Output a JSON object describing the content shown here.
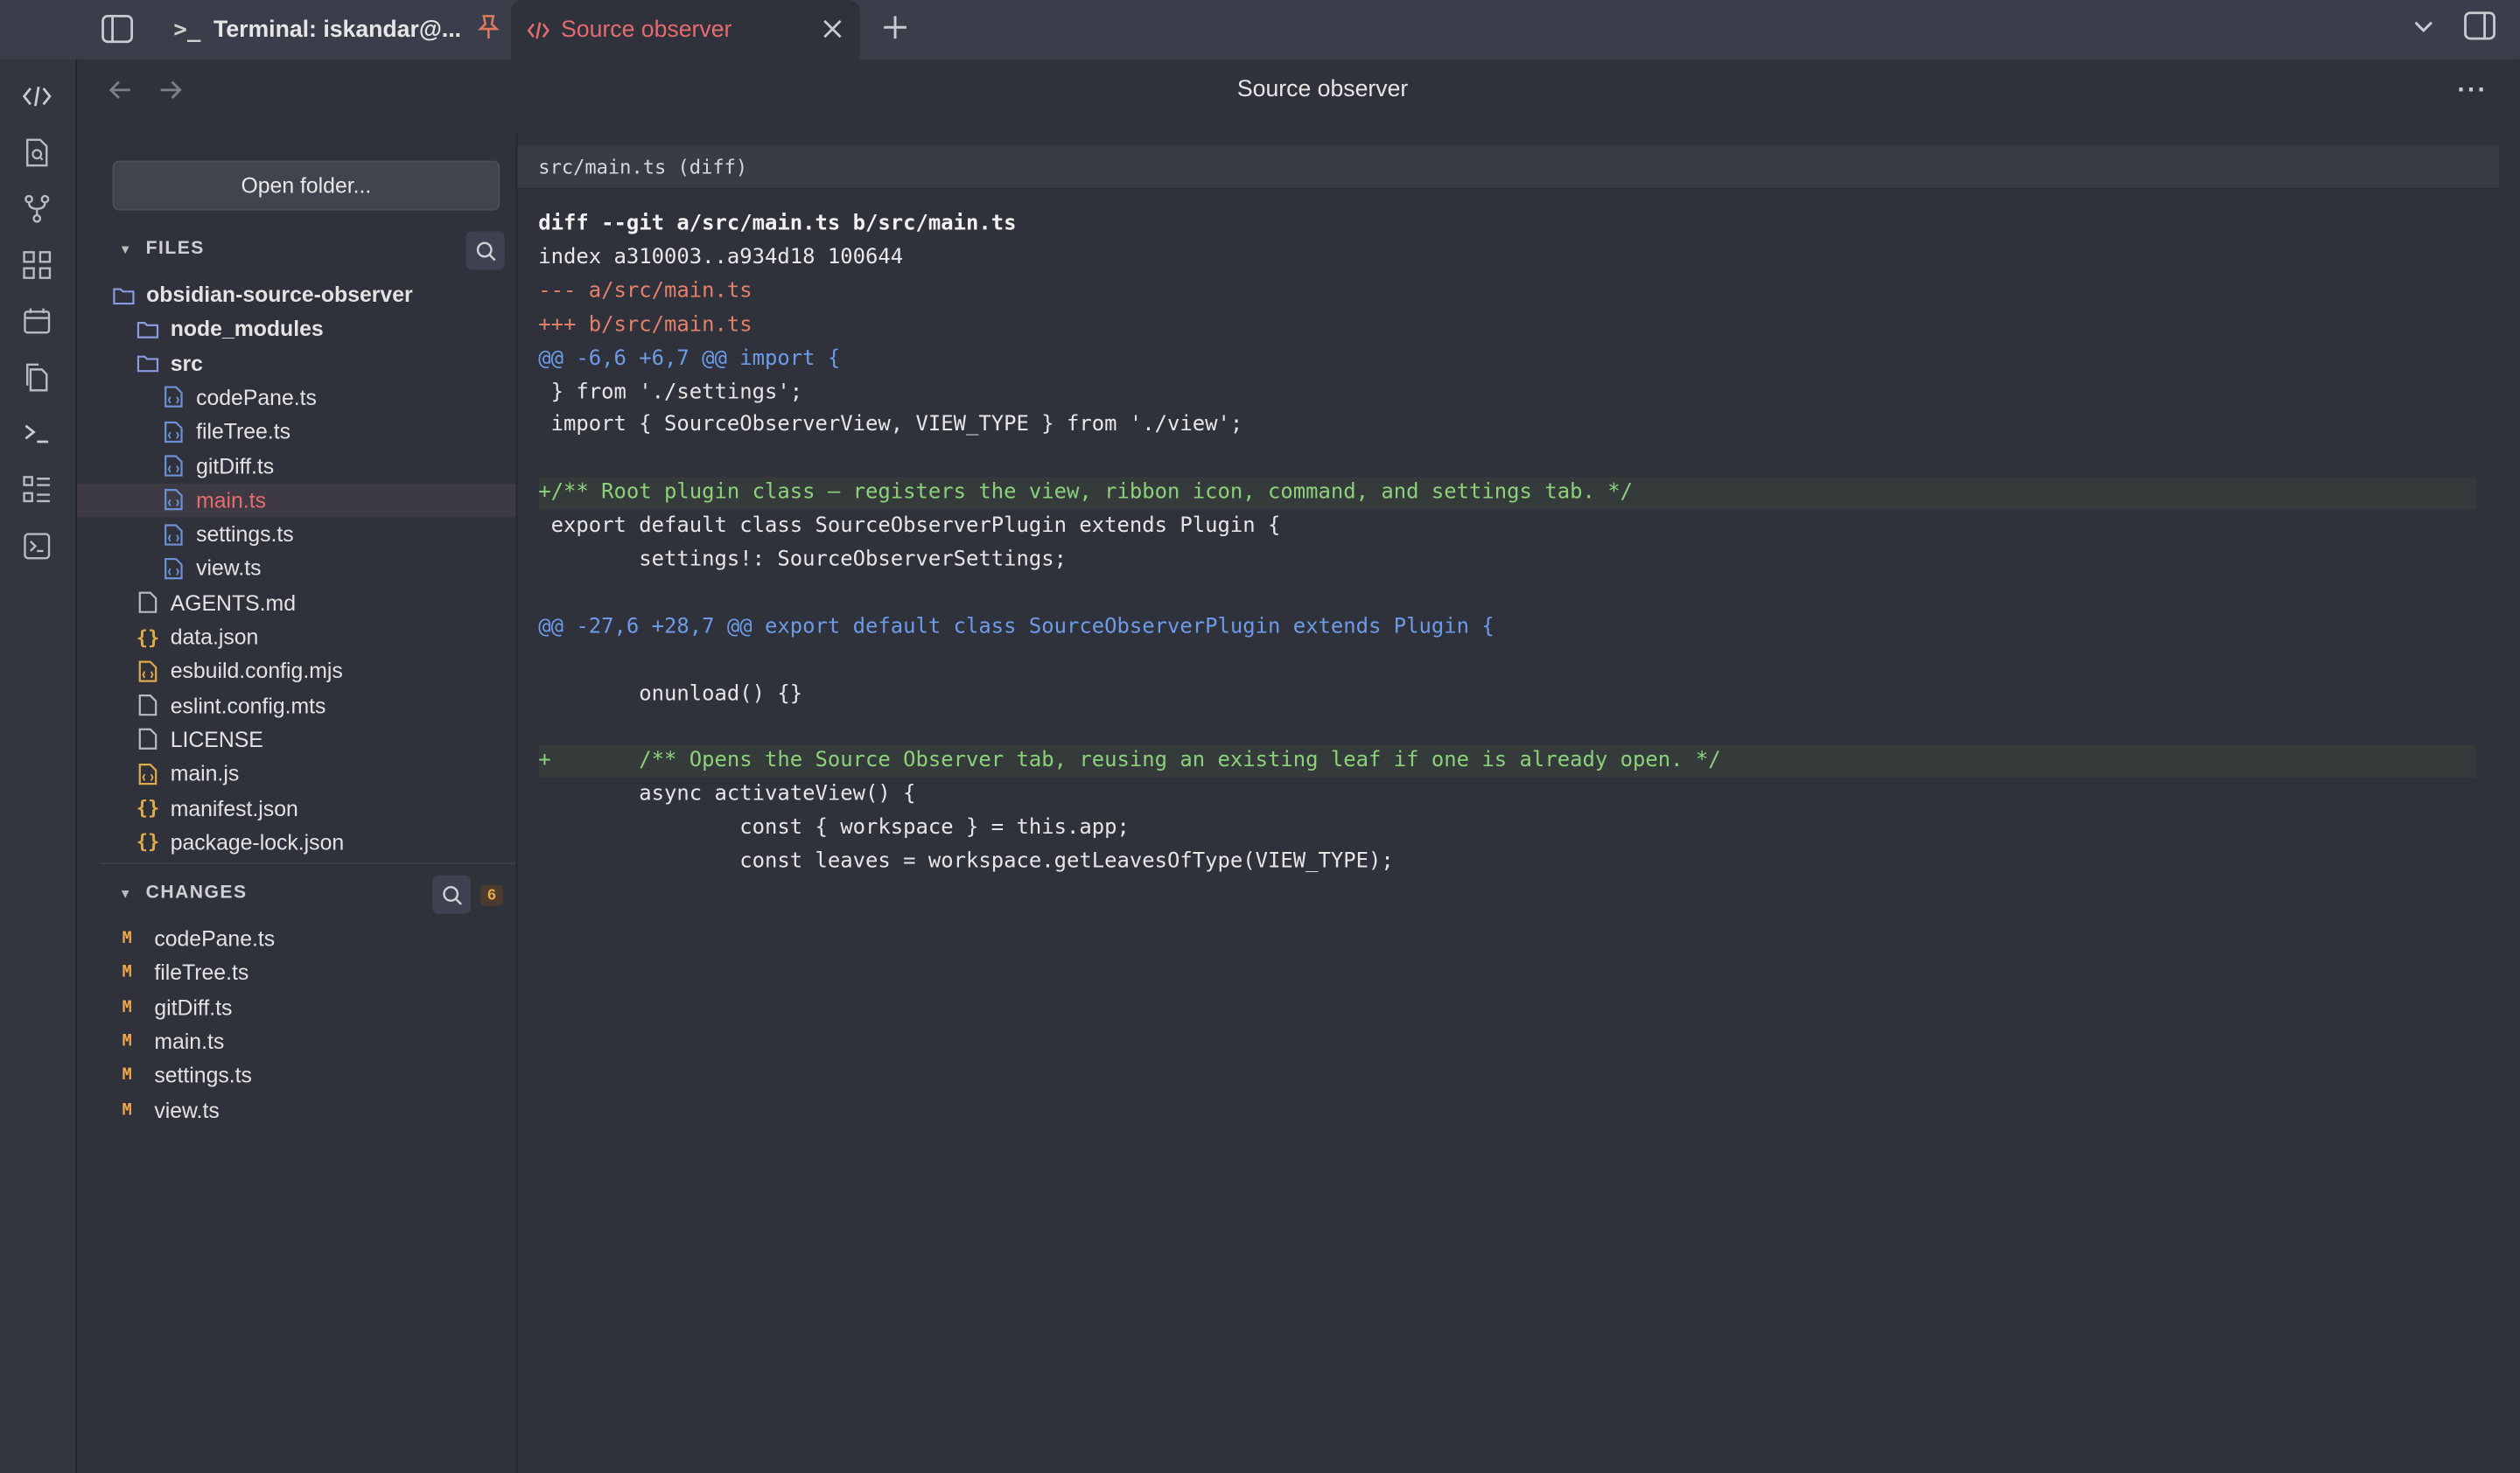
{
  "tabs": [
    {
      "label": "Terminal: iskandar@...",
      "icon": "terminal-icon",
      "pinned": true
    },
    {
      "label": "Source observer",
      "icon": "code-icon",
      "active": true
    }
  ],
  "header": {
    "title": "Source observer"
  },
  "sidebar": {
    "open_folder_label": "Open folder...",
    "files_heading": "FILES",
    "tree": [
      {
        "label": "obsidian-source-observer",
        "type": "folder",
        "depth": 0
      },
      {
        "label": "node_modules",
        "type": "folder",
        "depth": 1
      },
      {
        "label": "src",
        "type": "folder",
        "depth": 1
      },
      {
        "label": "codePane.ts",
        "type": "ts",
        "depth": 2
      },
      {
        "label": "fileTree.ts",
        "type": "ts",
        "depth": 2
      },
      {
        "label": "gitDiff.ts",
        "type": "ts",
        "depth": 2
      },
      {
        "label": "main.ts",
        "type": "ts",
        "depth": 2,
        "selected": true
      },
      {
        "label": "settings.ts",
        "type": "ts",
        "depth": 2
      },
      {
        "label": "view.ts",
        "type": "ts",
        "depth": 2
      },
      {
        "label": "AGENTS.md",
        "type": "doc",
        "depth": 1
      },
      {
        "label": "data.json",
        "type": "json",
        "depth": 1
      },
      {
        "label": "esbuild.config.mjs",
        "type": "js",
        "depth": 1
      },
      {
        "label": "eslint.config.mts",
        "type": "doc",
        "depth": 1
      },
      {
        "label": "LICENSE",
        "type": "doc",
        "depth": 1
      },
      {
        "label": "main.js",
        "type": "js",
        "depth": 1
      },
      {
        "label": "manifest.json",
        "type": "json",
        "depth": 1
      },
      {
        "label": "package-lock.json",
        "type": "json",
        "depth": 1
      }
    ],
    "changes_heading": "CHANGES",
    "changes_count": "6",
    "changes": [
      {
        "status": "M",
        "label": "codePane.ts"
      },
      {
        "status": "M",
        "label": "fileTree.ts"
      },
      {
        "status": "M",
        "label": "gitDiff.ts"
      },
      {
        "status": "M",
        "label": "main.ts"
      },
      {
        "status": "M",
        "label": "settings.ts"
      },
      {
        "status": "M",
        "label": "view.ts"
      }
    ]
  },
  "diff": {
    "header": "src/main.ts (diff)",
    "lines": [
      {
        "text": "diff --git a/src/main.ts b/src/main.ts",
        "kind": "meta"
      },
      {
        "text": "index a310003..a934d18 100644",
        "kind": "idx"
      },
      {
        "text": "--- a/src/main.ts",
        "kind": "del"
      },
      {
        "text": "+++ b/src/main.ts",
        "kind": "add-file"
      },
      {
        "text": "@@ -6,6 +6,7 @@ import {",
        "kind": "hunk"
      },
      {
        "text": " } from './settings';",
        "kind": "ctx"
      },
      {
        "text": " import { SourceObserverView, VIEW_TYPE } from './view';",
        "kind": "ctx"
      },
      {
        "text": "",
        "kind": "ctx"
      },
      {
        "text": "+/** Root plugin class — registers the view, ribbon icon, command, and settings tab. */",
        "kind": "add"
      },
      {
        "text": " export default class SourceObserverPlugin extends Plugin {",
        "kind": "ctx"
      },
      {
        "text": "        settings!: SourceObserverSettings;",
        "kind": "ctx"
      },
      {
        "text": "",
        "kind": "ctx"
      },
      {
        "text": "@@ -27,6 +28,7 @@ export default class SourceObserverPlugin extends Plugin {",
        "kind": "hunk"
      },
      {
        "text": "",
        "kind": "ctx"
      },
      {
        "text": "        onunload() {}",
        "kind": "ctx"
      },
      {
        "text": "",
        "kind": "ctx"
      },
      {
        "text": "+       /** Opens the Source Observer tab, reusing an existing leaf if one is already open. */",
        "kind": "add"
      },
      {
        "text": "        async activateView() {",
        "kind": "ctx"
      },
      {
        "text": "                const { workspace } = this.app;",
        "kind": "ctx"
      },
      {
        "text": "                const leaves = workspace.getLeavesOfType(VIEW_TYPE);",
        "kind": "ctx"
      }
    ]
  },
  "colors": {
    "accent": "#e56b6f",
    "hunk": "#6d9be8",
    "added": "#8cd17a",
    "removed": "#e3806a",
    "modified": "#f0a64c",
    "file_ts_icon": "#6d8fd6",
    "file_json_icon": "#e0a94a"
  }
}
